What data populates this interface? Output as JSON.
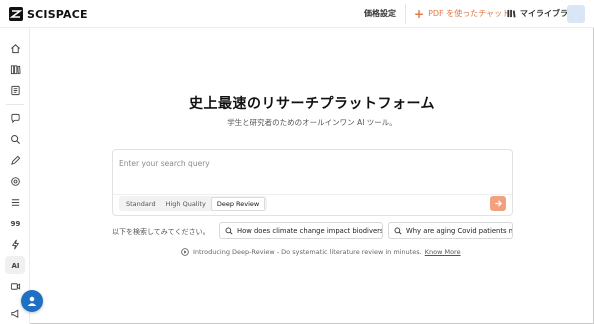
{
  "header": {
    "logo_text": "SCISPACE",
    "pricing_label": "価格設定",
    "chat_label": "PDF を使ったチャット",
    "library_label": "マイライブラリ"
  },
  "sidebar": {
    "items": [
      {
        "icon": "home-icon"
      },
      {
        "icon": "library-icon"
      },
      {
        "icon": "notebook-icon"
      },
      {
        "icon": "chat-icon"
      },
      {
        "icon": "literature-search-icon"
      },
      {
        "icon": "pen-icon"
      },
      {
        "icon": "extract-icon"
      },
      {
        "icon": "list-icon"
      },
      {
        "icon": "citation-icon",
        "text": "99"
      },
      {
        "icon": "flash-icon"
      },
      {
        "icon": "ai-detector-icon",
        "text": "AI"
      },
      {
        "icon": "video-icon"
      },
      {
        "icon": "megaphone-icon"
      }
    ]
  },
  "main": {
    "title": "史上最速のリサーチプラットフォーム",
    "subtitle": "学生と研究者のためのオールインワン AI ツール。",
    "search": {
      "placeholder": "Enter your search query",
      "value": ""
    },
    "modes": [
      {
        "label": "Standard",
        "active": false
      },
      {
        "label": "High Quality",
        "active": false
      },
      {
        "label": "Deep Review",
        "active": true
      }
    ],
    "suggestions_label": "以下を検索してみてください。",
    "suggestions": [
      "How does climate change impact biodiversity?",
      "Why are aging Covid patients more"
    ],
    "intro_text": "Introducing Deep-Review - Do systematic literature review in minutes.",
    "intro_link": "Know More"
  },
  "colors": {
    "accent": "#e07847",
    "submit": "#f0a27e",
    "fab": "#1f6fc2"
  }
}
